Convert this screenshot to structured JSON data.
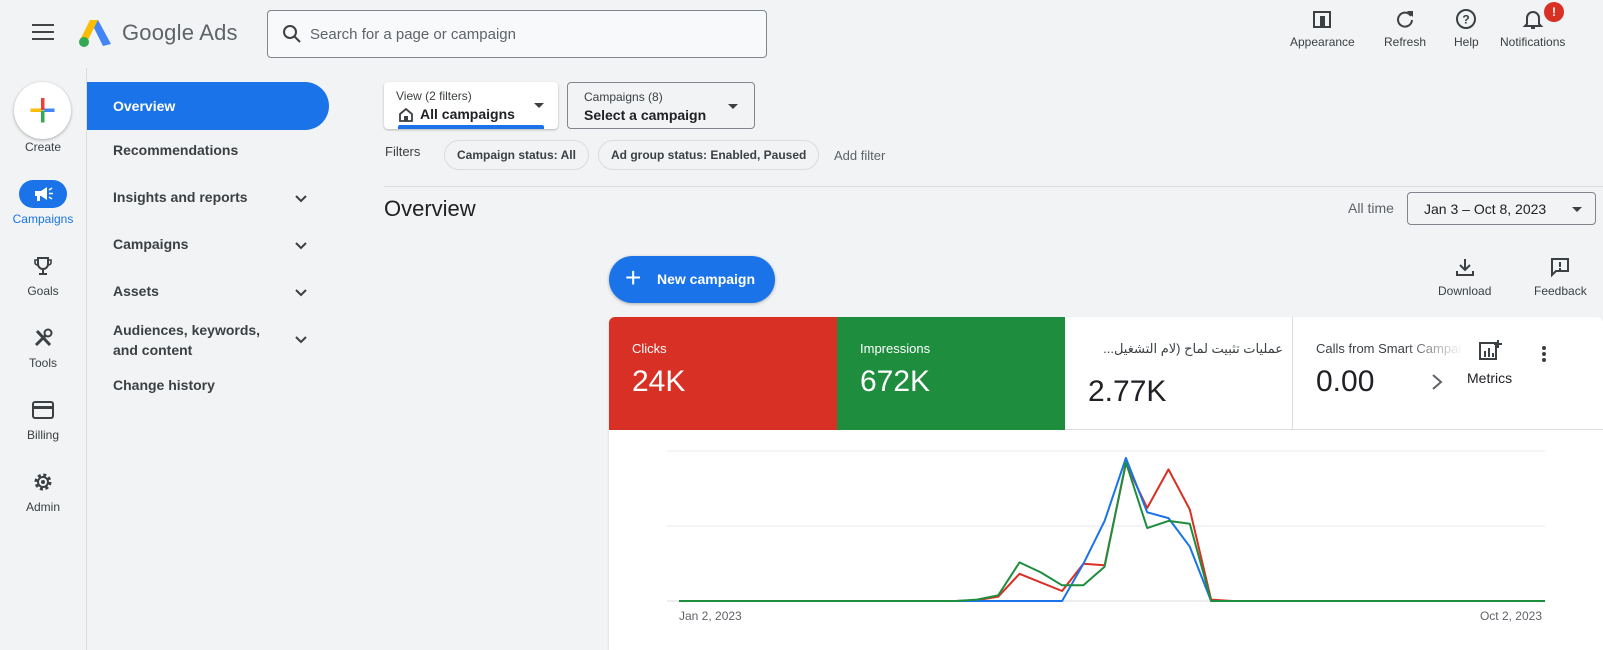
{
  "header": {
    "brand": "Google Ads",
    "search_placeholder": "Search for a page or campaign",
    "tools": [
      {
        "label": "Appearance",
        "icon": "appearance-icon"
      },
      {
        "label": "Refresh",
        "icon": "refresh-icon"
      },
      {
        "label": "Help",
        "icon": "help-icon"
      },
      {
        "label": "Notifications",
        "icon": "bell-icon",
        "badge": "!"
      }
    ]
  },
  "rail": {
    "create": "Create",
    "items": [
      {
        "label": "Campaigns",
        "icon": "megaphone-icon",
        "active": true
      },
      {
        "label": "Goals",
        "icon": "trophy-icon"
      },
      {
        "label": "Tools",
        "icon": "tools-icon"
      },
      {
        "label": "Billing",
        "icon": "credit-card-icon"
      },
      {
        "label": "Admin",
        "icon": "gear-icon"
      }
    ]
  },
  "nav": {
    "items": [
      {
        "label": "Overview",
        "active": true
      },
      {
        "label": "Recommendations"
      },
      {
        "label": "Insights and reports",
        "expandable": true
      },
      {
        "label": "Campaigns",
        "expandable": true
      },
      {
        "label": "Assets",
        "expandable": true
      },
      {
        "label": "Audiences, keywords, and content",
        "expandable": true
      },
      {
        "label": "Change history"
      }
    ]
  },
  "main": {
    "view": {
      "small": "View (2 filters)",
      "value": "All campaigns"
    },
    "campaigns": {
      "small": "Campaigns (8)",
      "value": "Select a campaign"
    },
    "filters_label": "Filters",
    "chips": [
      "Campaign status: All",
      "Ad group status: Enabled, Paused"
    ],
    "add_filter": "Add filter",
    "title": "Overview",
    "all_time": "All time",
    "date_range": "Jan 3 – Oct 8, 2023",
    "new_campaign": "New campaign",
    "download": "Download",
    "feedback": "Feedback",
    "metrics_button": "Metrics",
    "colors": {
      "accent": "#1a73e8",
      "clicks": "#d93025",
      "impressions": "#1e8e3e"
    }
  },
  "metrics": [
    {
      "label": "Clicks",
      "value": "24K"
    },
    {
      "label": "Impressions",
      "value": "672K"
    },
    {
      "label": "عمليات تثبيت لماح (لام التشغيل...",
      "value": "2.77K"
    },
    {
      "label": "Calls from Smart Campai",
      "value": "0.00"
    }
  ],
  "chart_data": {
    "type": "line",
    "x_start_label": "Jan 2, 2023",
    "x_end_label": "Oct 2, 2023",
    "x": [
      "Jan 2",
      "Jan 9",
      "Jan 16",
      "Jan 23",
      "Jan 30",
      "Feb 6",
      "Feb 13",
      "Feb 20",
      "Feb 27",
      "Mar 6",
      "Mar 13",
      "Mar 20",
      "Mar 27",
      "Apr 3",
      "Apr 10",
      "Apr 17",
      "Apr 24",
      "May 1",
      "May 8",
      "May 15",
      "May 22",
      "May 29",
      "Jun 5",
      "Jun 12",
      "Jun 19",
      "Jun 26",
      "Jul 3",
      "Jul 10",
      "Jul 17",
      "Jul 24",
      "Jul 31",
      "Aug 7",
      "Aug 14",
      "Aug 21",
      "Aug 28",
      "Sep 4",
      "Sep 11",
      "Sep 18",
      "Sep 25",
      "Oct 2"
    ],
    "ylim": [
      0,
      100
    ],
    "grid": true,
    "series": [
      {
        "color": "#d93025",
        "values": [
          0,
          0,
          0,
          0,
          0,
          0,
          0,
          0,
          0,
          0,
          0,
          0,
          0,
          0,
          0.5,
          3,
          19,
          13,
          7,
          26,
          25,
          96,
          65,
          92,
          64,
          1,
          0,
          0,
          0,
          0,
          0,
          0,
          0,
          0,
          0,
          0,
          0,
          0,
          0,
          0
        ]
      },
      {
        "color": "#1a73e8",
        "values": [
          0,
          0,
          0,
          0,
          0,
          0,
          0,
          0,
          0,
          0,
          0,
          0,
          0,
          0,
          0,
          0,
          0,
          0,
          0,
          26,
          56,
          100,
          62,
          58,
          38,
          0,
          0,
          0,
          0,
          0,
          0,
          0,
          0,
          0,
          0,
          0,
          0,
          0,
          0,
          0
        ]
      },
      {
        "color": "#1e8e3e",
        "values": [
          0,
          0,
          0,
          0,
          0,
          0,
          0,
          0,
          0,
          0,
          0,
          0,
          0,
          0,
          1,
          4,
          27,
          20,
          11,
          11,
          24,
          97,
          51,
          56,
          54,
          0,
          0,
          0,
          0,
          0,
          0,
          0,
          0,
          0,
          0,
          0,
          0,
          0,
          0,
          0
        ]
      }
    ]
  }
}
